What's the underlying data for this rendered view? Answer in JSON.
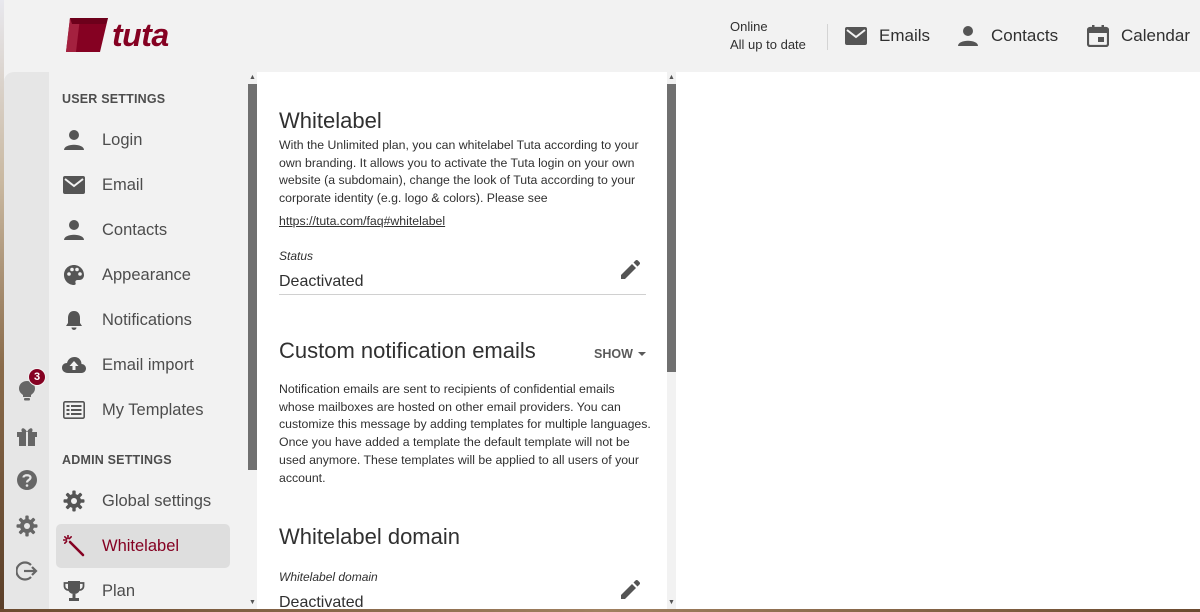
{
  "app": {
    "logo_text": "tuta",
    "colors": {
      "accent": "#850122",
      "badge": "#850122",
      "selected_bg": "#dedede"
    }
  },
  "header": {
    "status_line1": "Online",
    "status_line2": "All up to date",
    "nav": [
      {
        "label": "Emails",
        "icon": "mail-icon"
      },
      {
        "label": "Contacts",
        "icon": "person-icon"
      },
      {
        "label": "Calendar",
        "icon": "calendar-icon"
      }
    ]
  },
  "rail": {
    "news_badge": "3",
    "icons": [
      "lightbulb-icon",
      "gift-icon",
      "help-icon",
      "settings-icon",
      "logout-icon"
    ]
  },
  "settings_nav": {
    "user_section_title": "USER SETTINGS",
    "user_items": [
      {
        "label": "Login",
        "icon": "person-icon"
      },
      {
        "label": "Email",
        "icon": "mail-icon"
      },
      {
        "label": "Contacts",
        "icon": "person-icon"
      },
      {
        "label": "Appearance",
        "icon": "palette-icon"
      },
      {
        "label": "Notifications",
        "icon": "bell-icon"
      },
      {
        "label": "Email import",
        "icon": "cloud-upload-icon"
      },
      {
        "label": "My Templates",
        "icon": "template-icon"
      }
    ],
    "admin_section_title": "ADMIN SETTINGS",
    "admin_items": [
      {
        "label": "Global settings",
        "icon": "gear-icon"
      },
      {
        "label": "Whitelabel",
        "icon": "magic-wand-icon",
        "selected": true
      },
      {
        "label": "Plan",
        "icon": "trophy-icon"
      }
    ]
  },
  "content": {
    "whitelabel": {
      "title": "Whitelabel",
      "description": "With the Unlimited plan, you can whitelabel Tuta according to your own branding. It allows you to activate the Tuta login on your own website (a subdomain), change the look of Tuta according to your corporate identity (e.g. logo & colors). Please see",
      "link": "https://tuta.com/faq#whitelabel",
      "status_label": "Status",
      "status_value": "Deactivated"
    },
    "custom_notification": {
      "title": "Custom notification emails",
      "show_label": "SHOW",
      "description": "Notification emails are sent to recipients of confidential emails whose mailboxes are hosted on other email providers. You can customize this message by adding templates for multiple languages. Once you have added a template the default template will not be used anymore. These templates will be applied to all users of your account."
    },
    "whitelabel_domain": {
      "title": "Whitelabel domain",
      "field_label": "Whitelabel domain",
      "field_value": "Deactivated"
    }
  }
}
